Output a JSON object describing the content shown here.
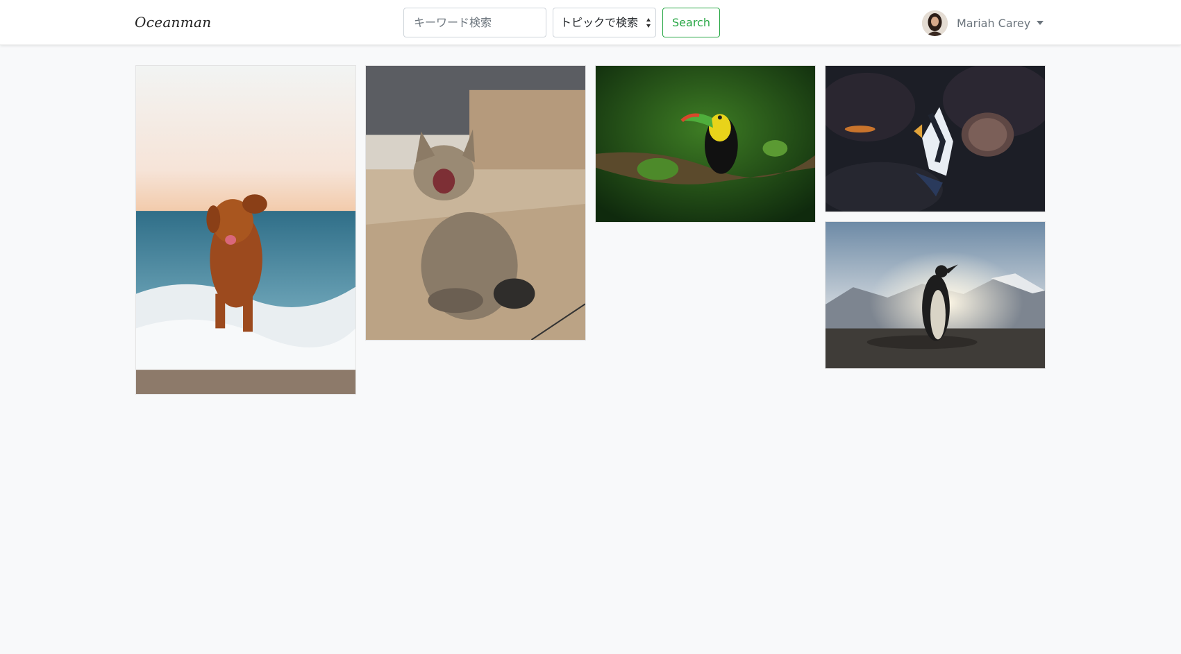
{
  "navbar": {
    "brand": "Oceanman",
    "search": {
      "placeholder": "キーワード検索",
      "value": ""
    },
    "topic_select": {
      "selected": "トピックで検索"
    },
    "search_button": "Search",
    "user": {
      "name": "Mariah Carey"
    }
  },
  "gallery": {
    "photos": [
      "dog",
      "cat",
      "toucan",
      "fish",
      "penguin"
    ]
  },
  "colors": {
    "accent": "#28a745",
    "background": "#f8f9fa"
  }
}
